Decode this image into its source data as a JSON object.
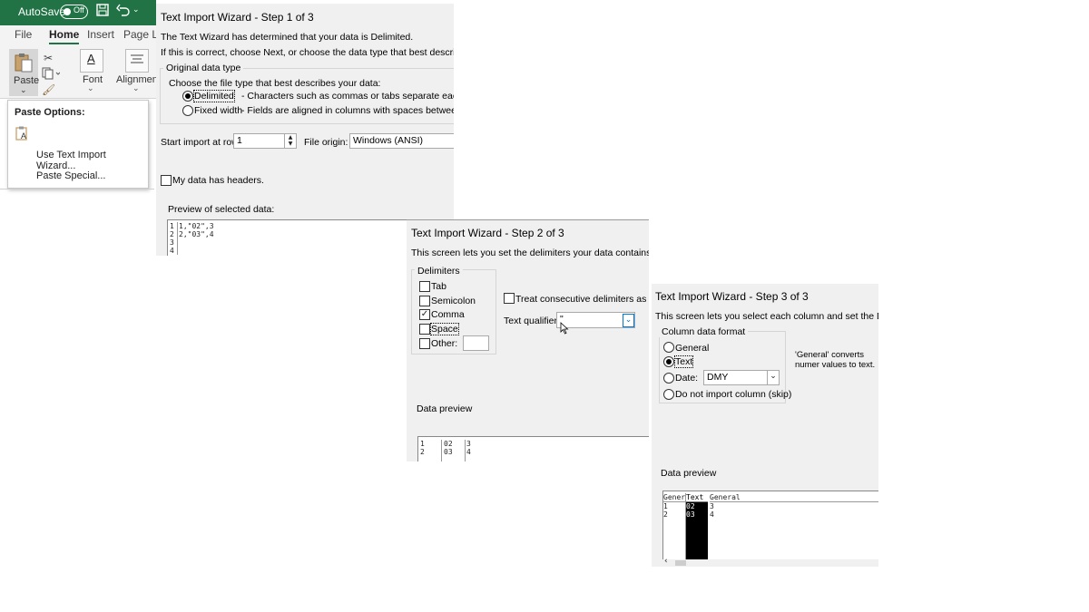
{
  "excel": {
    "autosave_label": "AutoSave",
    "autosave_state": "Off",
    "tabs": [
      "File",
      "Home",
      "Insert",
      "Page La"
    ],
    "ribbon": {
      "paste": "Paste",
      "font": "Font",
      "alignment": "Alignment"
    },
    "paste_menu": {
      "title": "Paste Options:",
      "items": [
        "Use Text Import Wizard...",
        "Paste Special..."
      ]
    },
    "accent": "#217346"
  },
  "step1": {
    "title": "Text Import Wizard - Step 1 of 3",
    "intro1": "The Text Wizard has determined that your data is Delimited.",
    "intro2": "If this is correct, choose Next, or choose the data type that best describes your data.",
    "group_label": "Original data type",
    "choose_label": "Choose the file type that best describes your data:",
    "options": [
      {
        "label": "Delimited",
        "desc": "- Characters such as commas or tabs separate each field.",
        "selected": true
      },
      {
        "label": "Fixed width",
        "desc": "- Fields are aligned in columns with spaces between each field.",
        "selected": false
      }
    ],
    "start_row_label": "Start import at row:",
    "start_row_value": "1",
    "file_origin_label": "File origin:",
    "file_origin_value": "Windows (ANSI)",
    "headers_label": "My data has headers.",
    "preview_label": "Preview of selected data:",
    "preview_lines": [
      "1,\"02\",3",
      "2,\"03\",4",
      "",
      ""
    ],
    "line_numbers": [
      "1",
      "2",
      "3",
      "4"
    ]
  },
  "step2": {
    "title": "Text Import Wizard - Step 2 of 3",
    "intro": "This screen lets you set the delimiters your data contains.  You can see h",
    "delimiters_label": "Delimiters",
    "delimiters": [
      {
        "label": "Tab",
        "checked": false
      },
      {
        "label": "Semicolon",
        "checked": false
      },
      {
        "label": "Comma",
        "checked": true
      },
      {
        "label": "Space",
        "checked": false
      },
      {
        "label": "Other:",
        "checked": false
      }
    ],
    "consecutive_label": "Treat consecutive delimiters as one",
    "qualifier_label": "Text qualifier:",
    "qualifier_value": "\"",
    "preview_label": "Data preview",
    "preview_rows": [
      [
        "1",
        "02",
        "3"
      ],
      [
        "2",
        "03",
        "4"
      ]
    ]
  },
  "step3": {
    "title": "Text Import Wizard - Step 3 of 3",
    "intro": "This screen lets you select each column and set the Data Format.",
    "group_label": "Column data format",
    "formats": [
      {
        "label": "General",
        "selected": false
      },
      {
        "label": "Text",
        "selected": true
      },
      {
        "label": "Date:",
        "selected": false
      },
      {
        "label": "Do not import column (skip)",
        "selected": false
      }
    ],
    "date_value": "DMY",
    "general_note": "'General' converts numer values to text.",
    "preview_label": "Data preview",
    "preview_headers": [
      "Gener",
      "Text",
      "General"
    ],
    "preview_rows": [
      [
        "1",
        "02",
        "3"
      ],
      [
        "2",
        "03",
        "4"
      ]
    ]
  }
}
